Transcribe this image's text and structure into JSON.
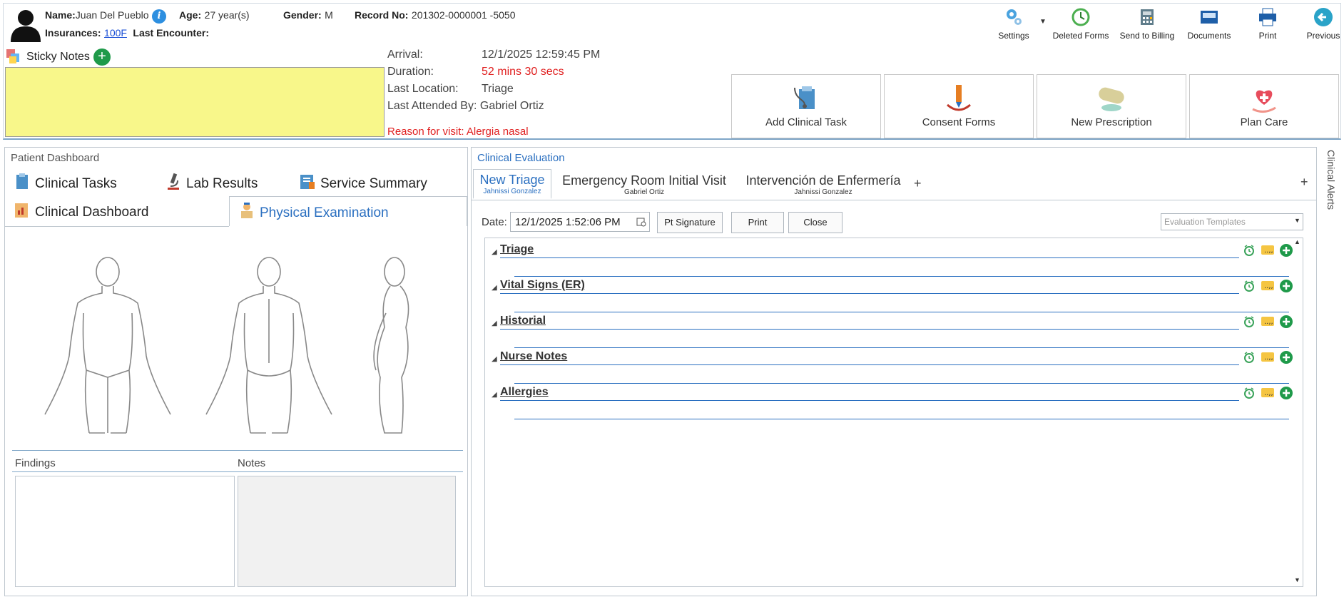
{
  "patient": {
    "name_label": "Name:",
    "name": "Juan Del Pueblo",
    "age_label": "Age:",
    "age": "27 year(s)",
    "gender_label": "Gender:",
    "gender": "M",
    "record_label": "Record No:",
    "record_no": "201302-0000001 -5050",
    "insurances_label": "Insurances:",
    "insurance": "100F",
    "last_encounter_label": "Last Encounter:",
    "info_glyph": "i"
  },
  "toolbar": {
    "settings": "Settings",
    "deleted_forms": "Deleted Forms",
    "send_to_billing": "Send to Billing",
    "documents": "Documents",
    "print": "Print",
    "previous": "Previous"
  },
  "sticky": {
    "label": "Sticky Notes",
    "add_glyph": "+"
  },
  "visit": {
    "arrival_label": "Arrival:",
    "arrival": "12/1/2025 12:59:45 PM",
    "duration_label": "Duration:",
    "duration": "52 mins 30 secs",
    "last_location_label": "Last Location:",
    "last_location": "Triage",
    "last_attended": "Last Attended By: Gabriel Ortiz",
    "reason": "Reason for visit: Alergia nasal"
  },
  "actions": {
    "add_clinical_task": "Add Clinical Task",
    "consent_forms": "Consent Forms",
    "new_prescription": "New Prescription",
    "plan_care": "Plan Care"
  },
  "dashboard": {
    "title": "Patient Dashboard",
    "tabs": [
      "Clinical Tasks",
      "Lab Results",
      "Service Summary",
      "Clinical Dashboard",
      "Physical Examination"
    ],
    "findings_label": "Findings",
    "notes_label": "Notes"
  },
  "evaluation": {
    "title": "Clinical Evaluation",
    "tabs": [
      {
        "label": "New Triage",
        "user": "Jahnissi Gonzalez"
      },
      {
        "label": "Emergency Room Initial Visit",
        "user": "Gabriel Ortiz"
      },
      {
        "label": "Intervención de Enfermería",
        "user": "Jahnissi Gonzalez"
      }
    ],
    "add_tab_glyph": "+",
    "date_label": "Date:",
    "date_value": "12/1/2025 1:52:06 PM",
    "pt_signature": "Pt Signature",
    "print": "Print",
    "close": "Close",
    "templates_placeholder": "Evaluation Templates",
    "sections": [
      "Triage",
      "Vital Signs (ER)",
      "Historial",
      "Nurse Notes",
      "Allergies"
    ]
  },
  "alerts": {
    "label": "Clinical Alerts"
  },
  "colors": {
    "accent": "#2a6fc0",
    "sticky_bg": "#f8f78a",
    "alert_red": "#e02020",
    "add_green": "#1f9a4a"
  }
}
